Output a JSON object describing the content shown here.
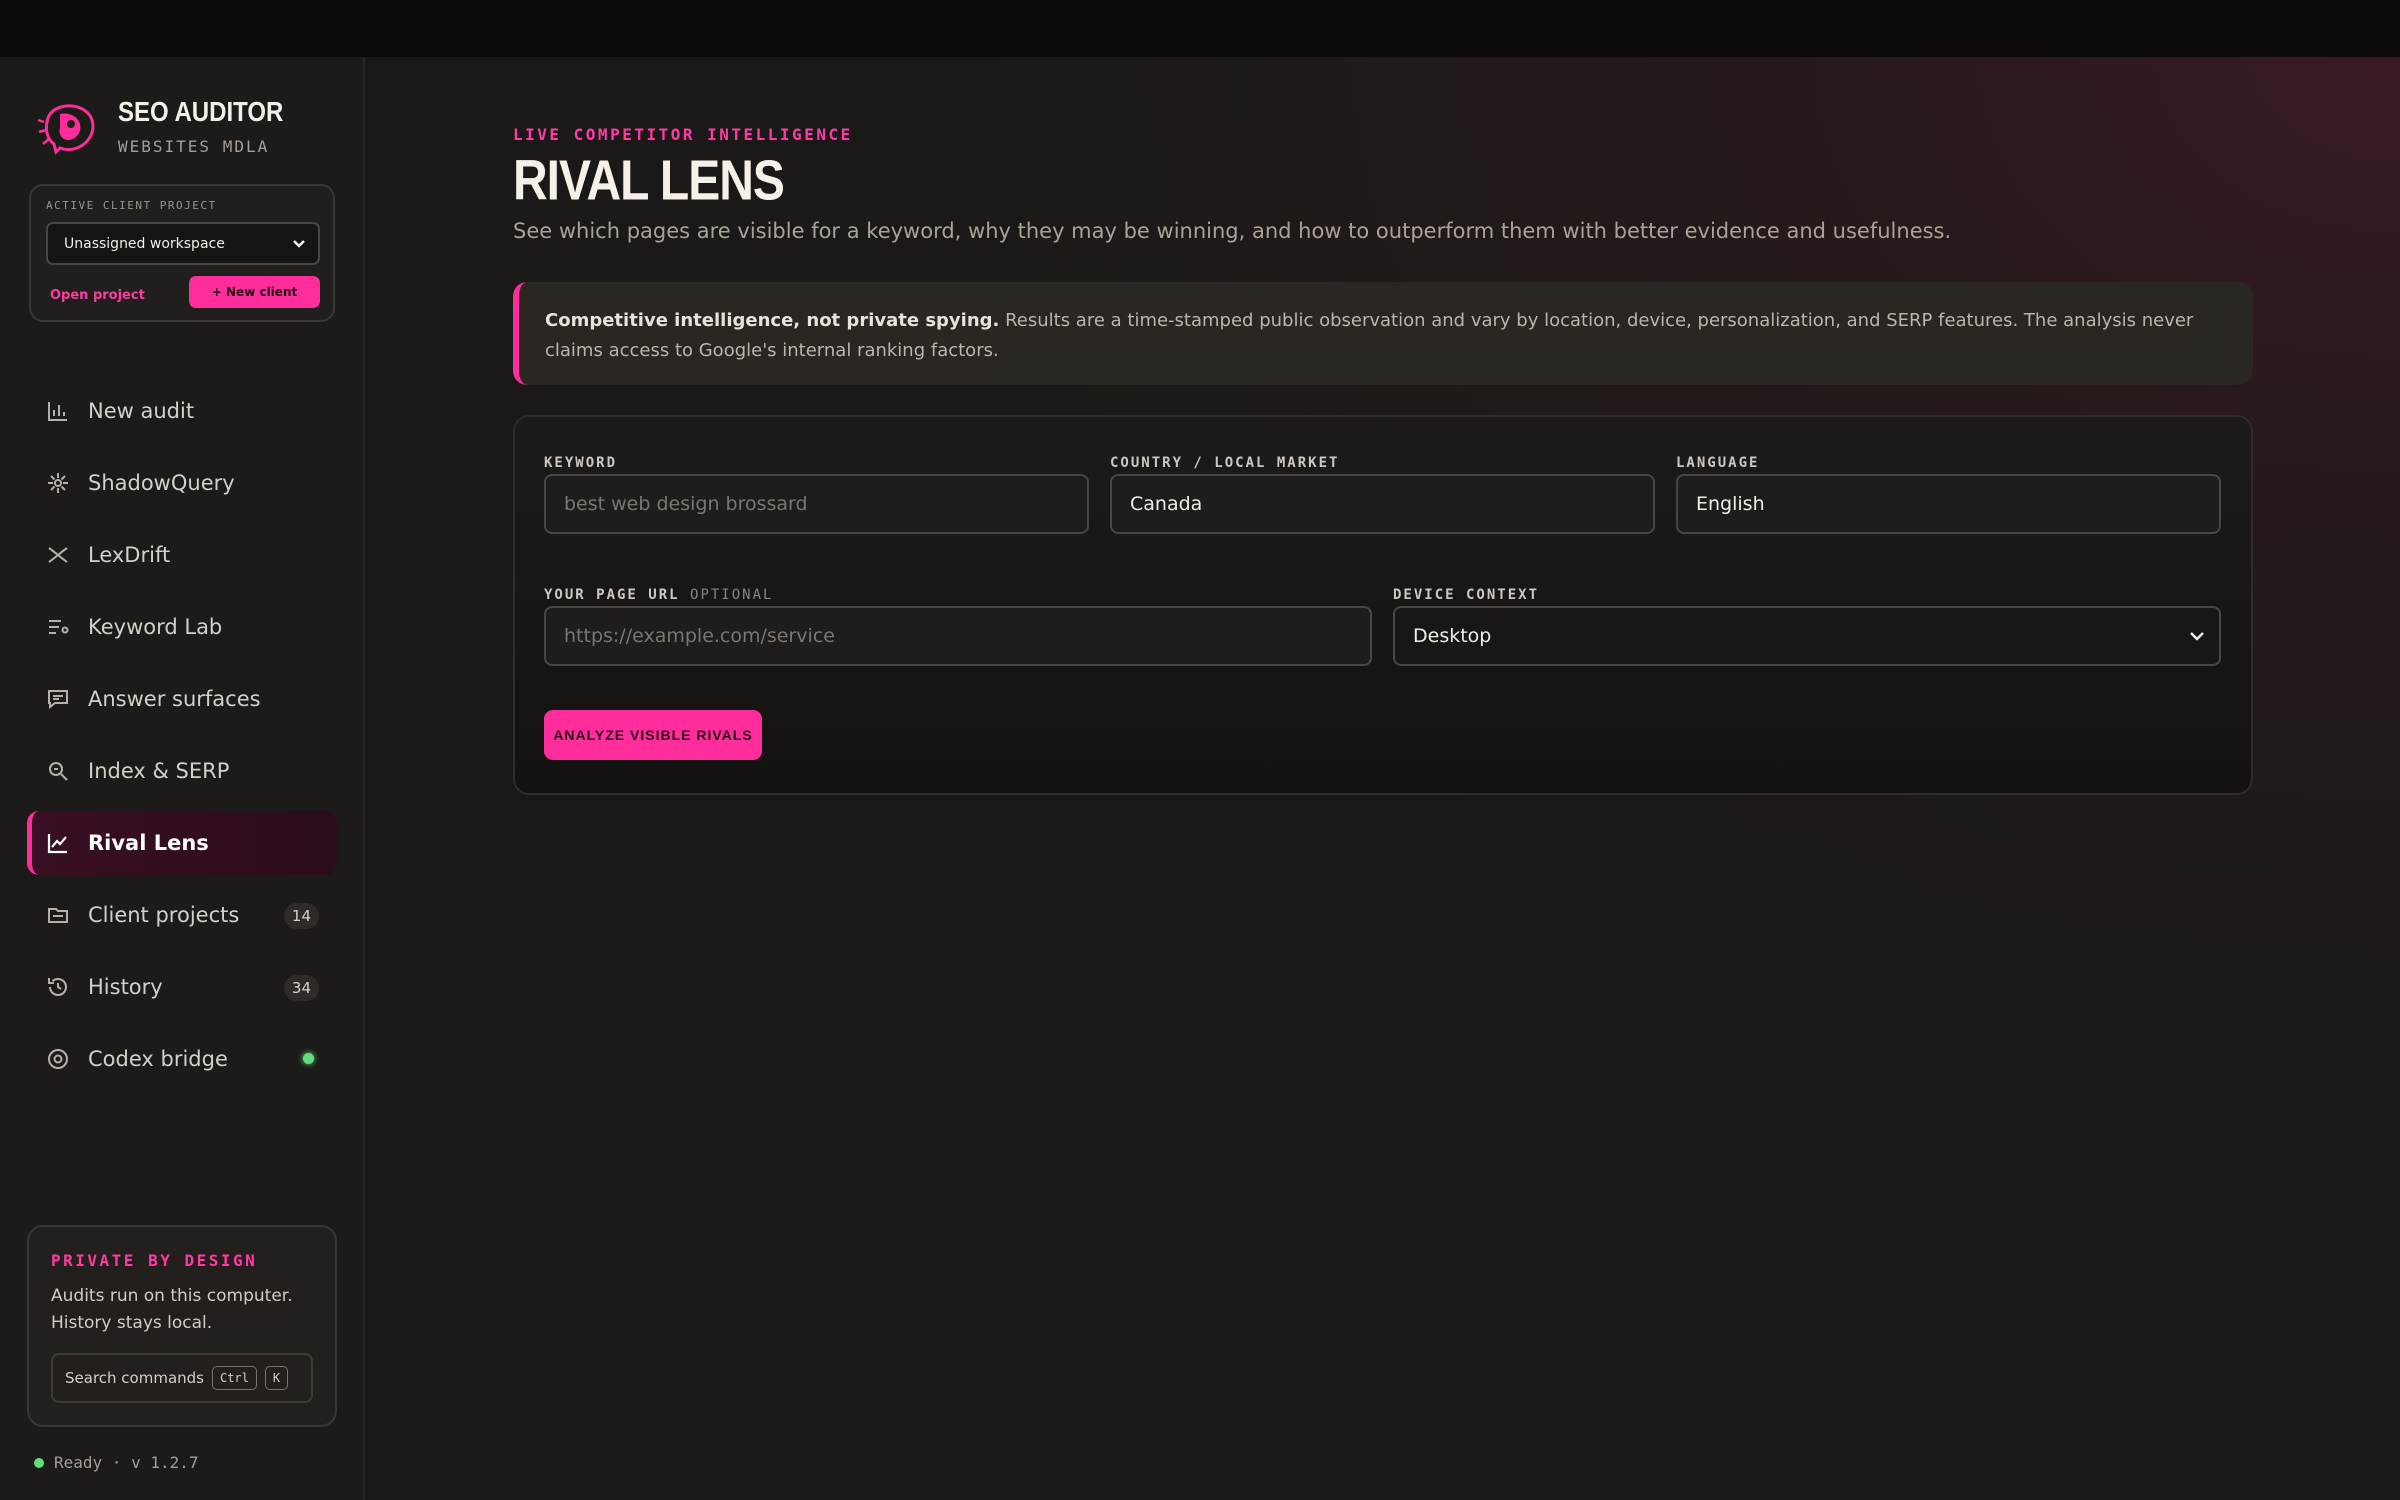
{
  "brand": {
    "title": "SEO AUDITOR",
    "subtitle": "WEBSITES MDLA"
  },
  "client": {
    "label": "ACTIVE CLIENT PROJECT",
    "selected": "Unassigned workspace",
    "open_link": "Open project",
    "new_button": "+ New client"
  },
  "nav": [
    {
      "label": "New audit",
      "icon": "bar-chart-icon"
    },
    {
      "label": "ShadowQuery",
      "icon": "sparkle-icon"
    },
    {
      "label": "LexDrift",
      "icon": "cross-arrows-icon"
    },
    {
      "label": "Keyword Lab",
      "icon": "list-icon"
    },
    {
      "label": "Answer surfaces",
      "icon": "chat-icon"
    },
    {
      "label": "Index & SERP",
      "icon": "search-icon"
    },
    {
      "label": "Rival Lens",
      "icon": "trend-line-icon",
      "active": true
    },
    {
      "label": "Client projects",
      "icon": "folder-icon",
      "badge": "14"
    },
    {
      "label": "History",
      "icon": "history-icon",
      "badge": "34"
    },
    {
      "label": "Codex bridge",
      "icon": "gear-icon",
      "status": "online"
    }
  ],
  "private": {
    "title": "PRIVATE BY DESIGN",
    "text": "Audits run on this computer. History stays local.",
    "search_label": "Search commands",
    "kbd1": "Ctrl",
    "kbd2": "K"
  },
  "footer": {
    "status": "Ready · v 1.2.7"
  },
  "main": {
    "eyebrow": "LIVE COMPETITOR INTELLIGENCE",
    "title": "RIVAL LENS",
    "subtitle": "See which pages are visible for a keyword, why they may be winning, and how to outperform them with better evidence and usefulness.",
    "notice_bold": "Competitive intelligence, not private spying.",
    "notice_text": " Results are a time-stamped public observation and vary by location, device, personalization, and SERP features. The analysis never claims access to Google's internal ranking factors."
  },
  "form": {
    "keyword_label": "KEYWORD",
    "keyword_placeholder": "best web design brossard",
    "country_label": "COUNTRY / LOCAL MARKET",
    "country_value": "Canada",
    "language_label": "LANGUAGE",
    "language_value": "English",
    "url_label": "YOUR PAGE URL",
    "url_optional": "OPTIONAL",
    "url_placeholder": "https://example.com/service",
    "device_label": "DEVICE CONTEXT",
    "device_value": "Desktop",
    "analyze_button": "ANALYZE VISIBLE RIVALS"
  },
  "colors": {
    "accent": "#ff2d9b",
    "online": "#5fe07d"
  }
}
